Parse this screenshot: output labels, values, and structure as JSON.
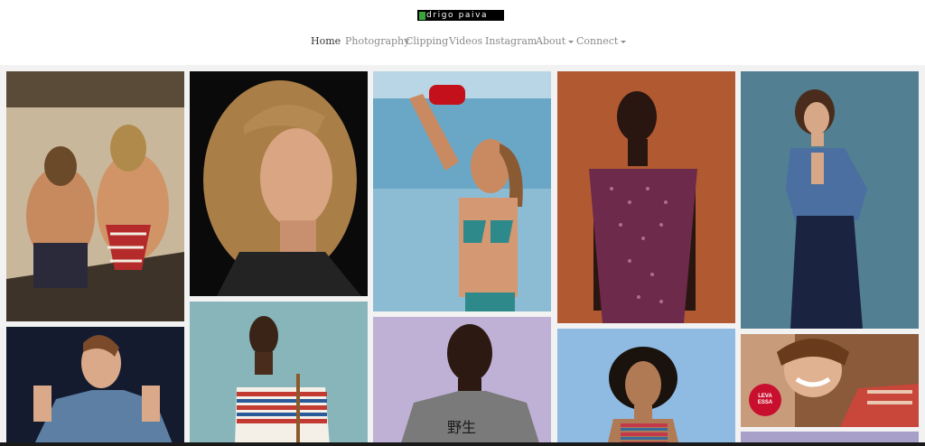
{
  "site": {
    "logo_text": "drigo paiva"
  },
  "nav": {
    "items": [
      {
        "label": "Home",
        "active": true,
        "dropdown": false
      },
      {
        "label": "Photography",
        "active": false,
        "dropdown": false
      },
      {
        "label": "Clipping",
        "active": false,
        "dropdown": false
      },
      {
        "label": "Videos",
        "active": false,
        "dropdown": false
      },
      {
        "label": "Instagram",
        "active": false,
        "dropdown": false
      },
      {
        "label": "About",
        "active": false,
        "dropdown": true
      },
      {
        "label": "Connect",
        "active": false,
        "dropdown": true
      }
    ]
  },
  "gallery": {
    "photos": [
      {
        "id": "two-women-striped-swimsuits"
      },
      {
        "id": "blonde-woman-portrait"
      },
      {
        "id": "woman-bikini-pouring-water"
      },
      {
        "id": "woman-purple-dress-orange-bg"
      },
      {
        "id": "woman-denim-jacket"
      },
      {
        "id": "woman-denim-jacket-dark"
      },
      {
        "id": "woman-striped-top"
      },
      {
        "id": "man-grey-tshirt"
      },
      {
        "id": "woman-curly-hair-striped-top"
      },
      {
        "id": "smiling-woman-ad"
      }
    ],
    "ad_badge_text": "LEVA ESSA"
  }
}
